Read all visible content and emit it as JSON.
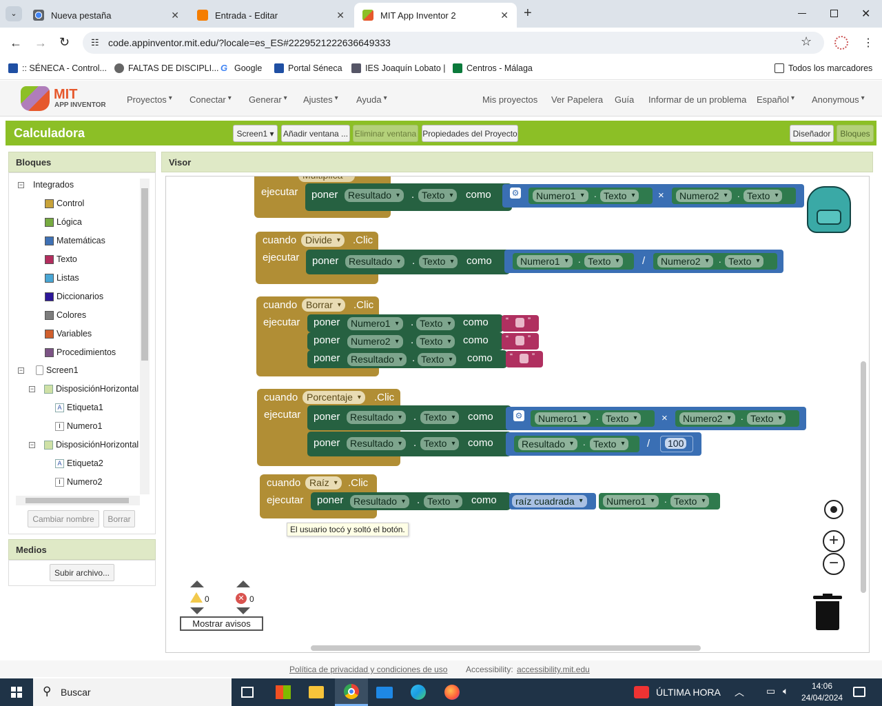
{
  "browser": {
    "tabs": [
      {
        "title": "Nueva pestaña",
        "close": "✕"
      },
      {
        "title": "Entrada - Editar",
        "close": "✕"
      },
      {
        "title": "MIT App Inventor 2",
        "close": "✕"
      }
    ],
    "new_tab": "+",
    "url": "code.appinventor.mit.edu/?locale=es_ES#2229521222636649333",
    "bookmarks": [
      ":: SÉNECA - Control...",
      "FALTAS DE DISCIPLI...",
      "Google",
      "Portal Séneca",
      "IES Joaquín Lobato |",
      "Centros - Málaga"
    ],
    "all_bookmarks": "Todos los marcadores"
  },
  "app": {
    "logo_mit": "MIT",
    "logo_sub": "APP INVENTOR",
    "menu": [
      "Proyectos",
      "Conectar",
      "Generar",
      "Ajustes",
      "Ayuda"
    ],
    "menu_right": [
      "Mis proyectos",
      "Ver Papelera",
      "Guía",
      "Informar de un problema",
      "Español",
      "Anonymous"
    ],
    "project_name": "Calculadora",
    "toolbar": {
      "screen": "Screen1",
      "add": "Añadir ventana ...",
      "remove": "Eliminar ventana",
      "props": "Propiedades del Proyecto"
    },
    "mode": {
      "designer": "Diseñador",
      "blocks": "Bloques"
    }
  },
  "blocks_panel": {
    "title": "Bloques",
    "builtin": "Integrados",
    "categories": [
      {
        "label": "Control",
        "color": "#c8a33a"
      },
      {
        "label": "Lógica",
        "color": "#77ab41"
      },
      {
        "label": "Matemáticas",
        "color": "#3f71b5"
      },
      {
        "label": "Texto",
        "color": "#b32d5e"
      },
      {
        "label": "Listas",
        "color": "#49a6d4"
      },
      {
        "label": "Diccionarios",
        "color": "#2d1799"
      },
      {
        "label": "Colores",
        "color": "#7d7d7d"
      },
      {
        "label": "Variables",
        "color": "#d05f2d"
      },
      {
        "label": "Procedimientos",
        "color": "#7c5385"
      }
    ],
    "components": [
      "Screen1",
      "DisposiciónHorizontal",
      "Etiqueta1",
      "Numero1",
      "DisposiciónHorizontal",
      "Etiqueta2",
      "Numero2"
    ],
    "rename": "Cambiar nombre",
    "delete": "Borrar"
  },
  "media": {
    "title": "Medios",
    "upload": "Subir archivo..."
  },
  "viewer": {
    "title": "Visor",
    "kw": {
      "when": "cuando",
      "do": "ejecutar",
      "set": "poner",
      "as": "como",
      "click": ".Clic",
      "dot": "."
    },
    "blocks": {
      "multiplica": {
        "button": "Multiplica",
        "target": "Resultado",
        "prop": "Texto",
        "a": "Numero1",
        "b": "Numero2",
        "op": "×"
      },
      "divide": {
        "button": "Divide",
        "target": "Resultado",
        "prop": "Texto",
        "a": "Numero1",
        "b": "Numero2",
        "op": "/"
      },
      "borrar": {
        "button": "Borrar",
        "targets": [
          "Numero1",
          "Numero2",
          "Resultado"
        ],
        "prop": "Texto"
      },
      "porcentaje": {
        "button": "Porcentaje",
        "target": "Resultado",
        "prop": "Texto",
        "a": "Numero1",
        "b": "Numero2",
        "op1": "×",
        "op2": "/",
        "n": "100"
      },
      "raiz": {
        "button": "Raíz",
        "target": "Resultado",
        "prop": "Texto",
        "fn": "raíz cuadrada",
        "a": "Numero1"
      }
    },
    "tooltip": "El usuario tocó y soltó el botón.",
    "warnings": "0",
    "errors": "0",
    "show_warnings": "Mostrar avisos"
  },
  "footer": {
    "privacy": "Política de privacidad y condiciones de uso",
    "accessibility": "Accessibility:",
    "acc_link": "accessibility.mit.edu"
  },
  "taskbar": {
    "search": "Buscar",
    "news": "ÚLTIMA HORA",
    "time": "14:06",
    "date": "24/04/2024"
  }
}
